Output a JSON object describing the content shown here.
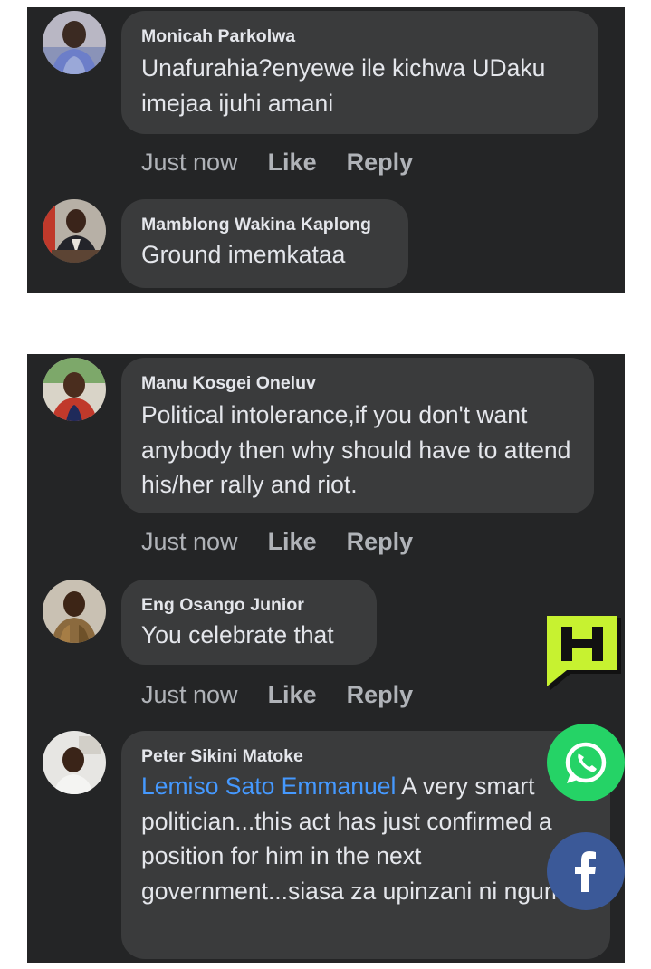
{
  "top_panel": {
    "comments": [
      {
        "author": "Monicah Parkolwa",
        "text": "Unafurahia?enyewe ile kichwa UDaku imejaa ijuhi amani",
        "actions": {
          "time": "Just now",
          "like": "Like",
          "reply": "Reply"
        }
      },
      {
        "author": "Mamblong Wakina Kaplong",
        "text": "Ground imemkataa"
      }
    ]
  },
  "bottom_panel": {
    "comments": [
      {
        "author": "Manu Kosgei Oneluv",
        "text": "Political intolerance,if you don't want anybody then why should have to attend his/her rally and riot.",
        "actions": {
          "time": "Just now",
          "like": "Like",
          "reply": "Reply"
        }
      },
      {
        "author": "Eng Osango Junior",
        "text": "You celebrate that",
        "actions": {
          "time": "Just now",
          "like": "Like",
          "reply": "Reply"
        }
      },
      {
        "author": "Peter Sikini Matoke",
        "mention": "Lemiso Sato Emmanuel",
        "text": "A  very smart politician...this act has just confirmed a position for him in the next government...siasa za upinzani ni ngumu"
      }
    ]
  },
  "overlays": {
    "brand_logo": "H",
    "brand_icon": "hustle-logo-icon",
    "whatsapp_icon": "whatsapp-icon",
    "facebook_icon": "facebook-icon",
    "colors": {
      "panel_bg": "#242526",
      "bubble_bg": "#3a3b3c",
      "mention": "#4599ff",
      "brand_lime": "#c7f230",
      "whatsapp_green": "#25d366",
      "facebook_blue": "#3b5998"
    }
  }
}
